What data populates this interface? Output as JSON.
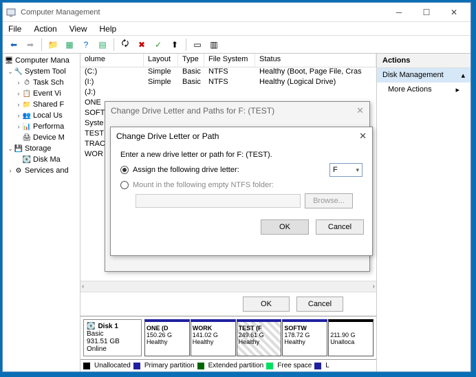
{
  "window": {
    "title": "Computer Management"
  },
  "menubar": [
    "File",
    "Action",
    "View",
    "Help"
  ],
  "tree": {
    "root": "Computer Mana",
    "systools": "System Tool",
    "items": [
      "Task Sch",
      "Event Vi",
      "Shared F",
      "Local Us",
      "Performa",
      "Device M"
    ],
    "storage": "Storage",
    "diskmgmt": "Disk Ma",
    "services": "Services and"
  },
  "columns": {
    "volume": "olume",
    "layout": "Layout",
    "type": "Type",
    "fs": "File System",
    "status": "Status"
  },
  "volumes": [
    {
      "v": "(C:)",
      "l": "Simple",
      "t": "Basic",
      "f": "NTFS",
      "s": "Healthy (Boot, Page File, Cras"
    },
    {
      "v": "(I:)",
      "l": "Simple",
      "t": "Basic",
      "f": "NTFS",
      "s": "Healthy (Logical Drive)"
    },
    {
      "v": "(J:)",
      "l": "",
      "t": "",
      "f": "",
      "s": ""
    },
    {
      "v": "ONE",
      "l": "",
      "t": "",
      "f": "",
      "s": ""
    },
    {
      "v": "SOFT",
      "l": "",
      "t": "",
      "f": "",
      "s": ""
    },
    {
      "v": "Syste",
      "l": "",
      "t": "",
      "f": "",
      "s": ""
    },
    {
      "v": "TEST",
      "l": "",
      "t": "",
      "f": "",
      "s": ""
    },
    {
      "v": "TRAC",
      "l": "",
      "t": "",
      "f": "",
      "s": ""
    },
    {
      "v": "WOR",
      "l": "",
      "t": "",
      "f": "",
      "s": ""
    }
  ],
  "disk": {
    "name": "Disk 1",
    "type": "Basic",
    "size": "931.51 GB",
    "status": "Online",
    "parts": [
      {
        "n": "ONE  (D",
        "s": "150.26 G",
        "st": "Healthy"
      },
      {
        "n": "WORK",
        "s": "141.02 G",
        "st": "Healthy"
      },
      {
        "n": "TEST  (F",
        "s": "249.61 G",
        "st": "Healthy",
        "sel": true
      },
      {
        "n": "SOFTW",
        "s": "178.72 G",
        "st": "Healthy"
      },
      {
        "n": "",
        "s": "211.90 G",
        "st": "Unalloca",
        "unalloc": true
      }
    ]
  },
  "legend": {
    "un": "Unallocated",
    "pp": "Primary partition",
    "ep": "Extended partition",
    "fs": "Free space",
    "l": "L"
  },
  "actions": {
    "header": "Actions",
    "main": "Disk Management",
    "more": "More Actions"
  },
  "panebuttons": {
    "ok": "OK",
    "cancel": "Cancel"
  },
  "dlg1": {
    "title": "Change Drive Letter and Paths for F: (TEST)"
  },
  "dlg2": {
    "title": "Change Drive Letter or Path",
    "prompt": "Enter a new drive letter or path for F: (TEST).",
    "opt1": "Assign the following drive letter:",
    "letter": "F",
    "opt2": "Mount in the following empty NTFS folder:",
    "browse": "Browse...",
    "ok": "OK",
    "cancel": "Cancel"
  }
}
